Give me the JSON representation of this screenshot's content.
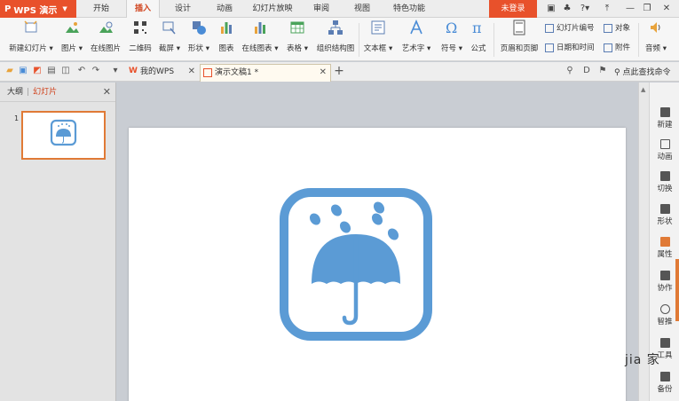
{
  "app": {
    "name": "WPS 演示",
    "logo": "P"
  },
  "menu_tabs": [
    {
      "label": "开始"
    },
    {
      "label": "插入"
    },
    {
      "label": "设计"
    },
    {
      "label": "动画"
    },
    {
      "label": "幻灯片放映"
    },
    {
      "label": "审阅"
    },
    {
      "label": "视图"
    },
    {
      "label": "特色功能"
    }
  ],
  "login_label": "未登录",
  "window_icons": [
    "skin-icon",
    "shirt-icon",
    "help-icon",
    "upload-icon",
    "minimize-icon",
    "restore-icon",
    "close-icon"
  ],
  "ribbon": {
    "buttons": [
      {
        "label": "新建幻灯片 ▾"
      },
      {
        "label": "图片 ▾"
      },
      {
        "label": "在线图片"
      },
      {
        "label": "二维码"
      },
      {
        "label": "截屏 ▾"
      },
      {
        "label": "形状 ▾"
      },
      {
        "label": "图表"
      },
      {
        "label": "在线图表 ▾"
      },
      {
        "label": "表格 ▾"
      },
      {
        "label": "组织结构图"
      },
      {
        "label": "文本框 ▾"
      },
      {
        "label": "艺术字 ▾"
      },
      {
        "label": "符号 ▾"
      },
      {
        "label": "公式"
      },
      {
        "label": "页眉和页脚"
      },
      {
        "label": "音频 ▾"
      }
    ],
    "small": [
      {
        "label": "幻灯片编号"
      },
      {
        "label": "对象"
      },
      {
        "label": "日期和时间"
      },
      {
        "label": "附件"
      }
    ]
  },
  "doc_tabs": [
    {
      "label": "我的WPS"
    },
    {
      "label": "演示文稿1 *"
    }
  ],
  "search_label": "点此查找命令",
  "left_panel": {
    "tab_outline": "大纲",
    "tab_slides": "幻灯片",
    "slide_number": "1"
  },
  "right_sidebar": [
    {
      "label": "新建"
    },
    {
      "label": "动画"
    },
    {
      "label": "切换"
    },
    {
      "label": "形状"
    },
    {
      "label": "属性"
    },
    {
      "label": "协作"
    },
    {
      "label": "智推"
    },
    {
      "label": "工具"
    },
    {
      "label": "备份"
    }
  ],
  "watermark": "jia 家",
  "colors": {
    "accent": "#e8512b",
    "icon_blue": "#5b9bd5"
  }
}
